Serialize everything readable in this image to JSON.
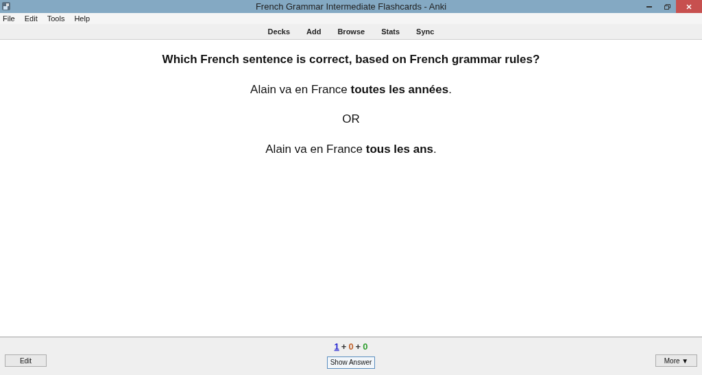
{
  "window": {
    "title": "French Grammar Intermediate Flashcards - Anki"
  },
  "menu": [
    "File",
    "Edit",
    "Tools",
    "Help"
  ],
  "toolbar": [
    "Decks",
    "Add",
    "Browse",
    "Stats",
    "Sync"
  ],
  "card": {
    "question": "Which French sentence is correct, based on French grammar rules?",
    "lines": [
      "Alain va en France **toutes les années**.",
      "OR",
      "Alain va en France **tous les ans**."
    ]
  },
  "counts": [
    {
      "text": "1",
      "color": "#1c1cd0",
      "selected": true
    },
    {
      "text": "0",
      "color": "#c0622c",
      "selected": false
    },
    {
      "text": "0",
      "color": "#2e9e2e",
      "selected": false
    }
  ],
  "count_separator": "+",
  "buttons": {
    "edit": "Edit",
    "show_answer": "Show Answer",
    "more": "More ▼"
  }
}
